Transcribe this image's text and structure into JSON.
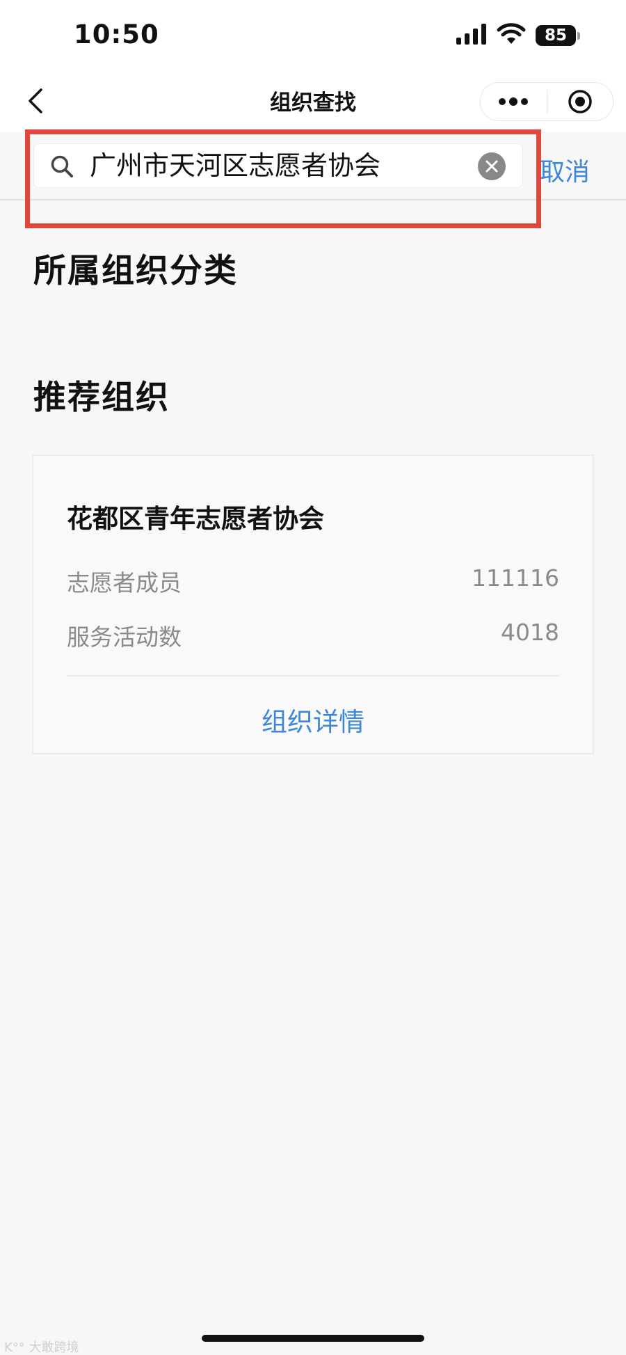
{
  "status_bar": {
    "time": "10:50",
    "battery": "85",
    "icons": [
      "signal-icon",
      "wifi-icon",
      "battery-icon"
    ]
  },
  "nav": {
    "title": "组织查找",
    "icons": [
      "back-icon",
      "more-icon",
      "close-mini-program-icon"
    ]
  },
  "search": {
    "value": "广州市天河区志愿者协会",
    "cancel_label": "取消",
    "icons": [
      "search-icon",
      "clear-icon"
    ]
  },
  "sections": {
    "category_heading": "所属组织分类",
    "recommend_heading": "推荐组织"
  },
  "recommended_org": {
    "name": "花都区青年志愿者协会",
    "stats": [
      {
        "label": "志愿者成员",
        "value": "111116"
      },
      {
        "label": "服务活动数",
        "value": "4018"
      }
    ],
    "detail_label": "组织详情"
  },
  "colors": {
    "accent": "#3d86d8",
    "highlight": "#e0483e",
    "background": "#f7f7f7"
  }
}
